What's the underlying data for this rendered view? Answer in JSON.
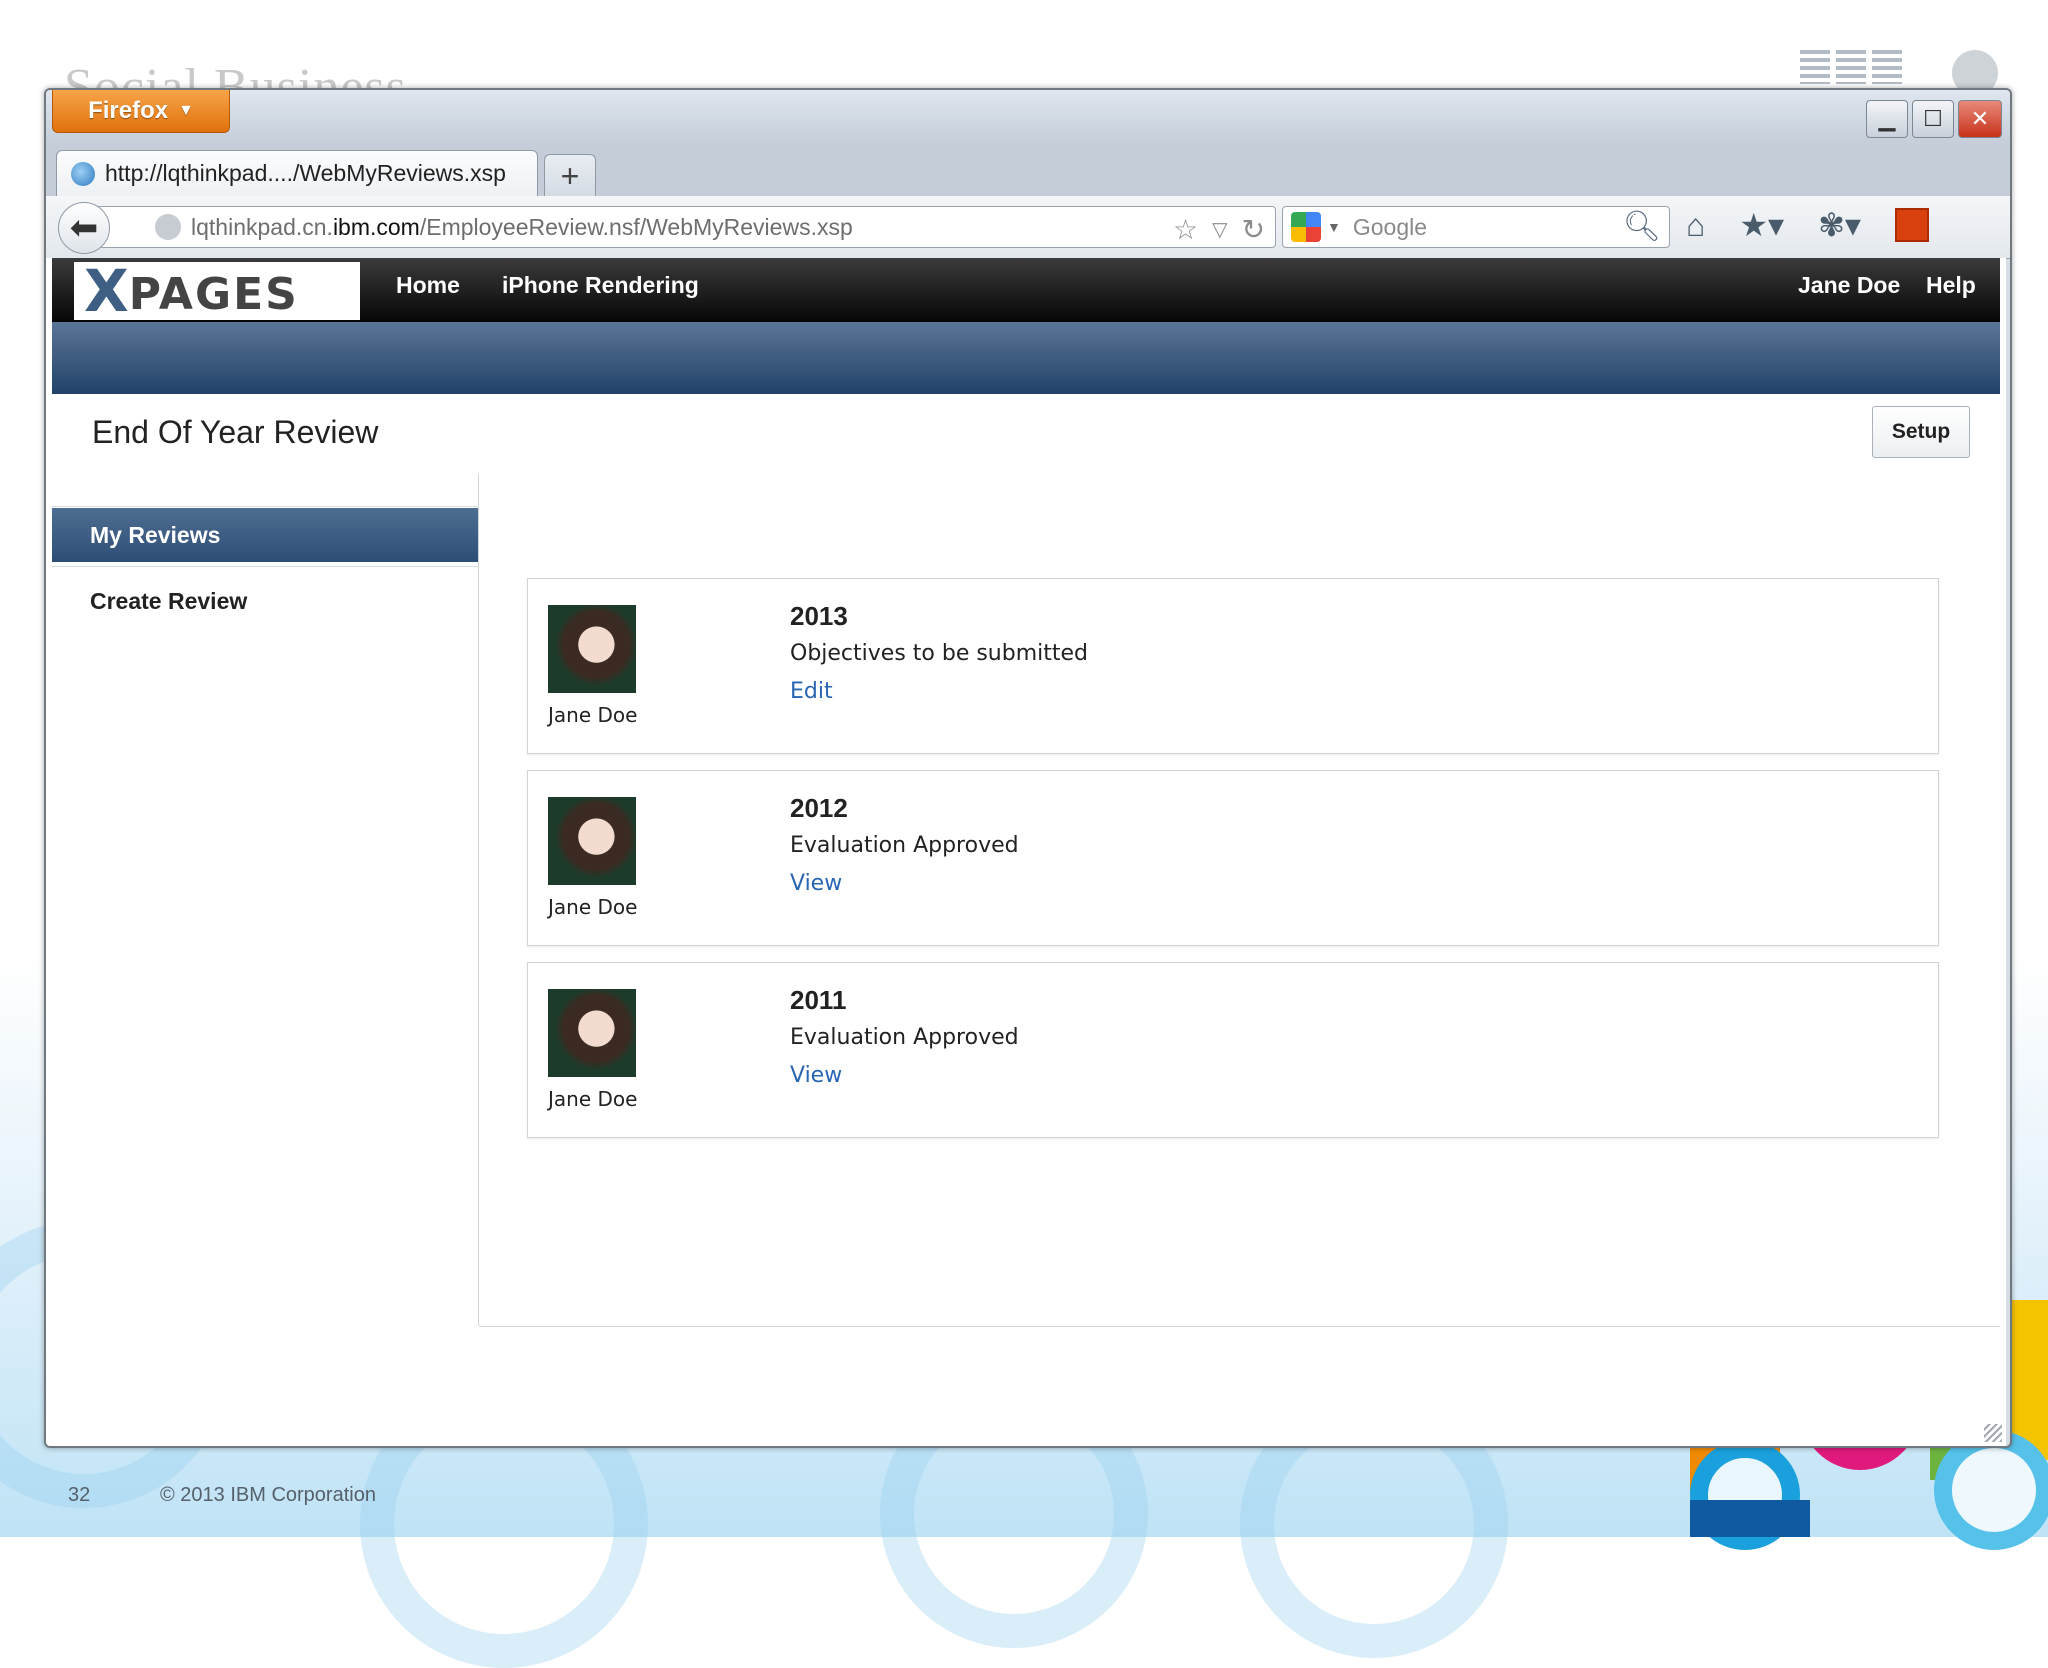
{
  "slide": {
    "title": "Social Business",
    "page_number": "32",
    "copyright": "© 2013 IBM Corporation"
  },
  "browser": {
    "menu_button": "Firefox",
    "tab_title": "http://lqthinkpad..../WebMyReviews.xsp",
    "new_tab_label": "+",
    "url_prefix": "lqthinkpad.cn.",
    "url_host": "ibm.com",
    "url_path": "/EmployeeReview.nsf/WebMyReviews.xsp",
    "search_placeholder": "Google"
  },
  "app": {
    "logo_x": "X",
    "logo_rest": "PAGES",
    "nav": [
      "Home",
      "iPhone Rendering"
    ],
    "user_name": "Jane Doe",
    "help_label": "Help",
    "page_title": "End Of Year Review",
    "setup_label": "Setup"
  },
  "sidebar": {
    "items": [
      {
        "label": "My Reviews",
        "active": true
      },
      {
        "label": "Create Review",
        "active": false
      }
    ]
  },
  "reviews": [
    {
      "name": "Jane Doe",
      "year": "2013",
      "status": "Objectives to be submitted",
      "action": "Edit"
    },
    {
      "name": "Jane Doe",
      "year": "2012",
      "status": "Evaluation Approved",
      "action": "View"
    },
    {
      "name": "Jane Doe",
      "year": "2011",
      "status": "Evaluation Approved",
      "action": "View"
    }
  ],
  "colors": {
    "firefox_orange": "#e8821c",
    "header_black": "#0a0a0a",
    "header_blue": "#2e4e76",
    "link_blue": "#2a65b3"
  }
}
